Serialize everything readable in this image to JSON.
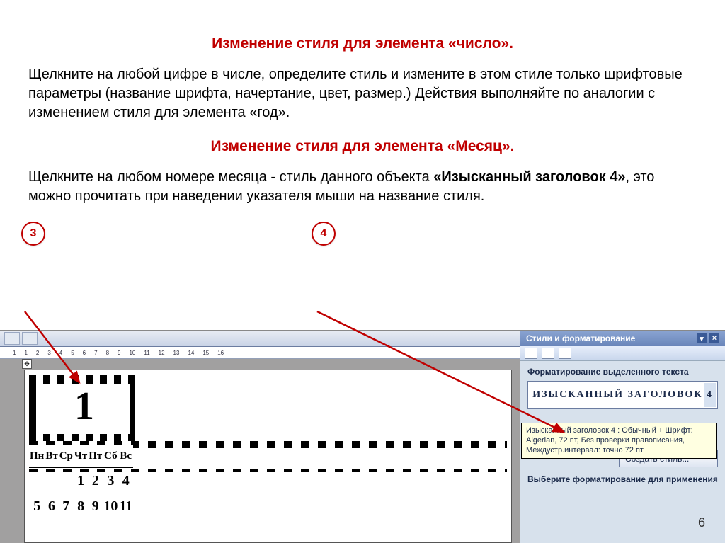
{
  "heading1": "Изменение стиля для  элемента «число».",
  "para1": "Щелкните на любой цифре в числе, определите стиль и измените в этом стиле только шрифтовые параметры (название шрифта, начертание, цвет, размер.) Действия  выполняйте по аналогии с  изменением стиля для элемента «год».",
  "heading2": "Изменение стиля для элемента «Месяц».",
  "para2a": "Щелкните на любом номере месяца  - стиль данного объекта  ",
  "para2b": "«Изысканный заголовок 4»",
  "para2c": ", это можно прочитать при наведении указателя мыши на название стиля.",
  "callouts": {
    "c3": "3",
    "c4": "4"
  },
  "ruler_marks": "1 · · 1 · · 2 · · 3 · · 4 · · 5 · · 6 · · 7 · · 8 · · 9 · · 10 · · 11 · · 12 · · 13 · · 14 · · 15 · · 16",
  "big_number": "1",
  "calendar": {
    "days": [
      "Пн",
      "Вт",
      "Ср",
      "Чт",
      "Пт",
      "Сб",
      "Вс"
    ],
    "rows": [
      [
        "",
        "",
        "",
        "1",
        "2",
        "3",
        "4"
      ],
      [
        "5",
        "6",
        "7",
        "8",
        "9",
        "10",
        "11"
      ]
    ]
  },
  "pane": {
    "title": "Стили и форматирование",
    "section_label": "Форматирование выделенного текста",
    "style_preview": "ИЗЫСКАННЫЙ ЗАГОЛОВОК 4",
    "tooltip": "Изысканный заголовок 4 : Обычный + Шрифт: Algerian, 72 пт, Без проверки правописания, Междустр.интервал: точно 72 пт",
    "create_btn": "Создать стиль...",
    "apply_label": "Выберите форматирование для применения"
  },
  "page_number": "6"
}
